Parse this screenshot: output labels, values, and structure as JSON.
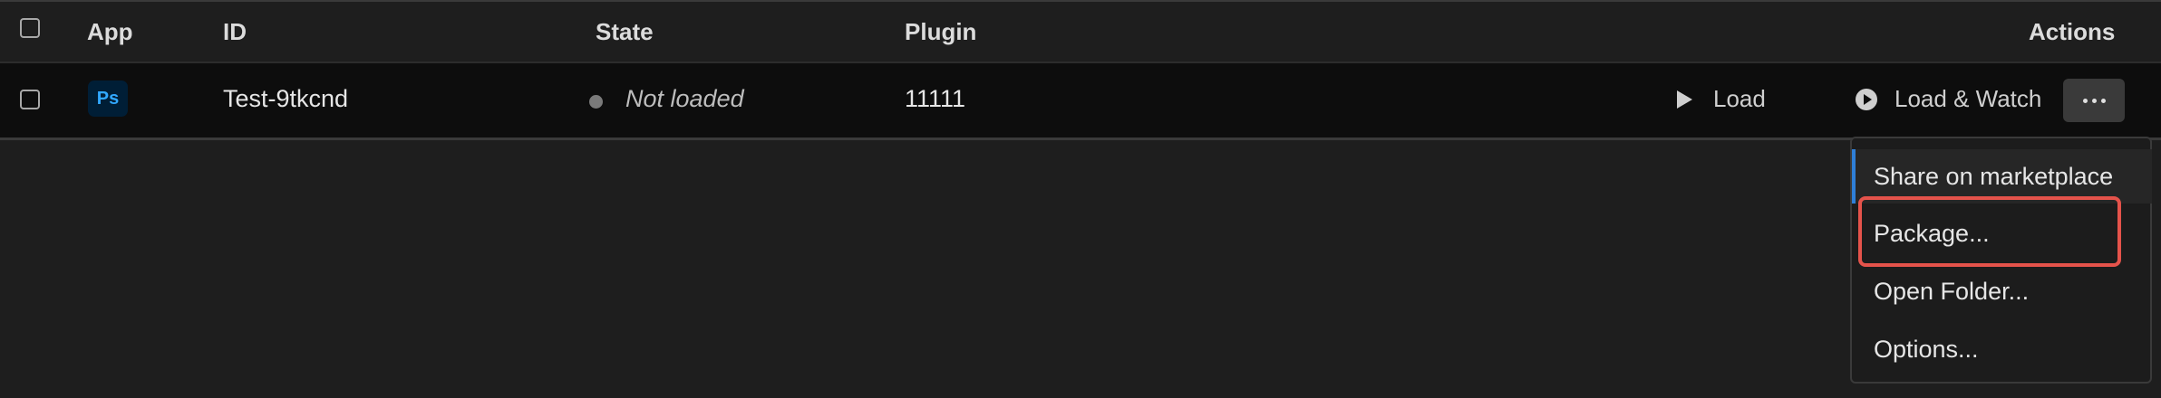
{
  "header": {
    "app": "App",
    "id": "ID",
    "state": "State",
    "plugin": "Plugin",
    "actions": "Actions"
  },
  "row": {
    "app_icon_text": "Ps",
    "id": "Test-9tkcnd",
    "state": "Not loaded",
    "plugin": "11111",
    "load_label": "Load",
    "load_watch_label": "Load & Watch"
  },
  "menu": {
    "items": [
      "Share on marketplace",
      "Package...",
      "Open Folder...",
      "Options..."
    ]
  },
  "colors": {
    "background": "#1e1e1e",
    "row_background": "#0d0d0d",
    "accent": "#2f7fd8",
    "highlight": "#e5534b",
    "photoshop_blue": "#31a8ff",
    "photoshop_bg": "#001e36"
  },
  "icons": [
    "checkbox-icon",
    "photoshop-icon",
    "play-icon",
    "play-circle-icon",
    "more-icon"
  ]
}
